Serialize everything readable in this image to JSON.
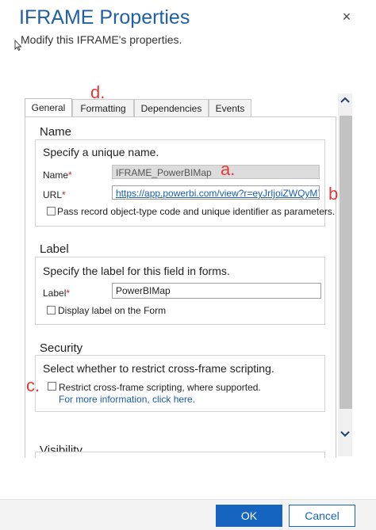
{
  "dialog": {
    "title": "IFRAME Properties",
    "subtitle": "Modify this IFRAME's properties.",
    "close_glyph": "×"
  },
  "tabs": [
    {
      "label": "General",
      "active": true
    },
    {
      "label": "Formatting",
      "active": false
    },
    {
      "label": "Dependencies",
      "active": false
    },
    {
      "label": "Events",
      "active": false
    }
  ],
  "name_section": {
    "title": "Name",
    "description": "Specify a unique name.",
    "name_label": "Name",
    "name_value": "IFRAME_PowerBIMap",
    "url_label": "URL",
    "url_value": "https://app.powerbi.com/view?r=eyJrIjoiZWQyMTJh",
    "required_mark": "*",
    "pass_params_label": "Pass record object-type code and unique identifier as parameters.",
    "pass_params_checked": false
  },
  "label_section": {
    "title": "Label",
    "description": "Specify the label for this field in forms.",
    "label_label": "Label",
    "label_value": "PowerBIMap",
    "display_label": "Display label on the Form",
    "display_checked": false
  },
  "security_section": {
    "title": "Security",
    "description": "Select whether to restrict cross-frame scripting.",
    "restrict_label": "Restrict cross-frame scripting, where supported.",
    "restrict_checked": false,
    "more_info_link": "For more information, click here."
  },
  "visibility_section": {
    "title": "Visibility"
  },
  "annotations": {
    "a": "a.",
    "b": "b.",
    "c": "c.",
    "d": "d."
  },
  "annotation_color": "#e23a3a",
  "buttons": {
    "ok": "OK",
    "cancel": "Cancel"
  },
  "icons": {
    "close": "close-icon",
    "scroll_up": "chevron-up-icon",
    "scroll_down": "chevron-down-icon",
    "cursor": "mouse-pointer-icon"
  },
  "accent_color": "#1565c0"
}
